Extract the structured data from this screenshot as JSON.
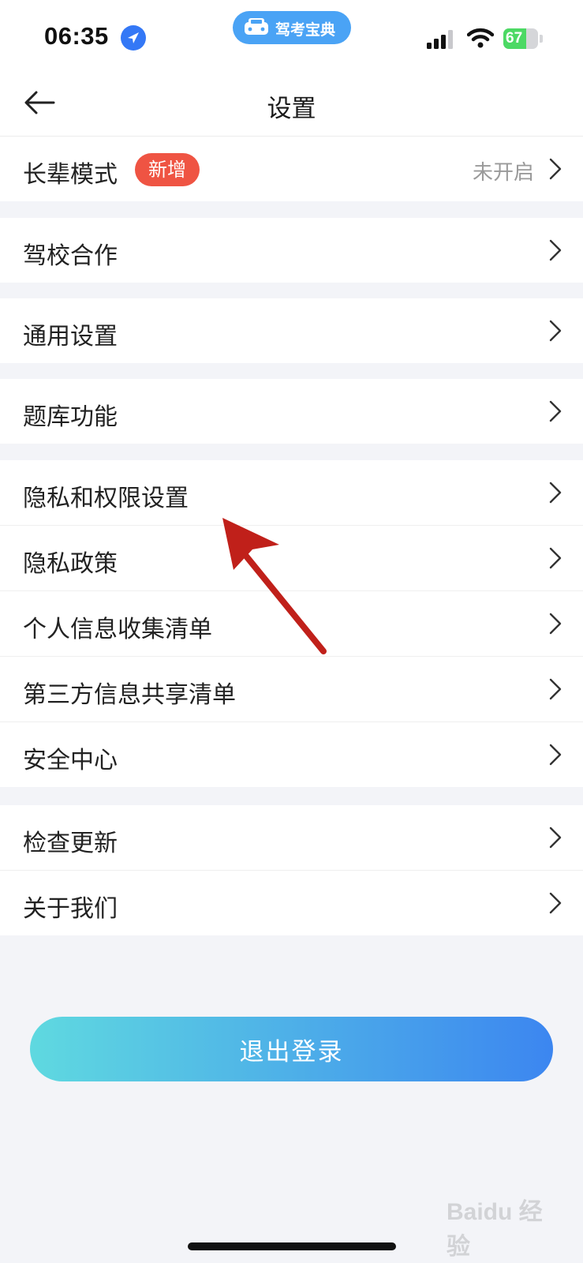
{
  "status_bar": {
    "time": "06:35",
    "app_pill_label": "驾考宝典",
    "battery_level": "67",
    "battery_fraction": 0.67,
    "signal_bars_active": 3
  },
  "header": {
    "back_icon": "back-arrow-icon",
    "title": "设置"
  },
  "groups": [
    {
      "items": [
        {
          "label": "长辈模式",
          "badge": "新增",
          "value": "未开启"
        }
      ]
    },
    {
      "items": [
        {
          "label": "驾校合作"
        }
      ]
    },
    {
      "items": [
        {
          "label": "通用设置"
        }
      ]
    },
    {
      "items": [
        {
          "label": "题库功能"
        }
      ]
    },
    {
      "items": [
        {
          "label": "隐私和权限设置"
        },
        {
          "label": "隐私政策"
        },
        {
          "label": "个人信息收集清单"
        },
        {
          "label": "第三方信息共享清单"
        },
        {
          "label": "安全中心"
        }
      ]
    },
    {
      "items": [
        {
          "label": "检查更新"
        },
        {
          "label": "关于我们"
        }
      ]
    }
  ],
  "logout_label": "退出登录",
  "watermark_text": "Baidu 经验",
  "colors": {
    "accent_start": "#5fd9e0",
    "accent_end": "#3c86f0",
    "badge": "#ef5443",
    "annotation_arrow": "#c0201a"
  }
}
